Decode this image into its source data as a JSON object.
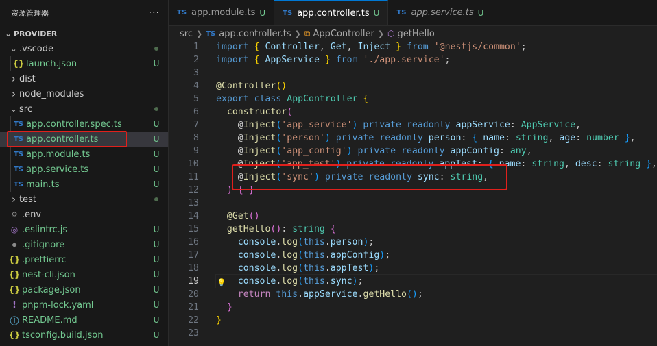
{
  "sidebar": {
    "title": "资源管理器",
    "more": "···",
    "section": "PROVIDER",
    "items": [
      {
        "label": ".vscode",
        "type": "folder",
        "open": true,
        "indent": 1,
        "icon": "",
        "badge": "dot"
      },
      {
        "label": "launch.json",
        "type": "file",
        "indent": 2,
        "icon": "{}",
        "badge": "U"
      },
      {
        "label": "dist",
        "type": "folder",
        "open": false,
        "indent": 1,
        "icon": "",
        "badge": ""
      },
      {
        "label": "node_modules",
        "type": "folder",
        "open": false,
        "indent": 1,
        "icon": "",
        "badge": ""
      },
      {
        "label": "src",
        "type": "folder",
        "open": true,
        "indent": 1,
        "icon": "",
        "badge": "dot"
      },
      {
        "label": "app.controller.spec.ts",
        "type": "file",
        "indent": 2,
        "icon": "TS",
        "badge": "U"
      },
      {
        "label": "app.controller.ts",
        "type": "file",
        "indent": 2,
        "icon": "TS",
        "badge": "U",
        "selected": true
      },
      {
        "label": "app.module.ts",
        "type": "file",
        "indent": 2,
        "icon": "TS",
        "badge": "U"
      },
      {
        "label": "app.service.ts",
        "type": "file",
        "indent": 2,
        "icon": "TS",
        "badge": "U"
      },
      {
        "label": "main.ts",
        "type": "file",
        "indent": 2,
        "icon": "TS",
        "badge": "U"
      },
      {
        "label": "test",
        "type": "folder",
        "open": false,
        "indent": 1,
        "icon": "",
        "badge": "dot"
      },
      {
        "label": ".env",
        "type": "file",
        "indent": 1,
        "icon": "gear",
        "badge": ""
      },
      {
        "label": ".eslintrc.js",
        "type": "file",
        "indent": 1,
        "icon": "eslint",
        "badge": "U"
      },
      {
        "label": ".gitignore",
        "type": "file",
        "indent": 1,
        "icon": "git",
        "badge": "U"
      },
      {
        "label": ".prettierrc",
        "type": "file",
        "indent": 1,
        "icon": "{}",
        "badge": "U"
      },
      {
        "label": "nest-cli.json",
        "type": "file",
        "indent": 1,
        "icon": "{}",
        "badge": "U"
      },
      {
        "label": "package.json",
        "type": "file",
        "indent": 1,
        "icon": "{}",
        "badge": "U"
      },
      {
        "label": "pnpm-lock.yaml",
        "type": "file",
        "indent": 1,
        "icon": "!",
        "badge": "U"
      },
      {
        "label": "README.md",
        "type": "file",
        "indent": 1,
        "icon": "info",
        "badge": "U"
      },
      {
        "label": "tsconfig.build.json",
        "type": "file",
        "indent": 1,
        "icon": "{}",
        "badge": "U"
      }
    ]
  },
  "tabs": [
    {
      "label": "app.module.ts",
      "badge": "U",
      "active": false,
      "preview": false
    },
    {
      "label": "app.controller.ts",
      "badge": "U",
      "active": true,
      "preview": false
    },
    {
      "label": "app.service.ts",
      "badge": "U",
      "active": false,
      "preview": true
    }
  ],
  "tab_icon": "TS",
  "breadcrumb": {
    "folder": "src",
    "file": "app.controller.ts",
    "class": "AppController",
    "method": "getHello"
  },
  "editor": {
    "current_line": 19,
    "lines": [
      [
        [
          "k",
          "import"
        ],
        [
          "p",
          " "
        ],
        [
          "b1",
          "{"
        ],
        [
          "v",
          " Controller"
        ],
        [
          "p",
          ", "
        ],
        [
          "v",
          "Get"
        ],
        [
          "p",
          ", "
        ],
        [
          "v",
          "Inject "
        ],
        [
          "b1",
          "}"
        ],
        [
          "p",
          " "
        ],
        [
          "k",
          "from"
        ],
        [
          "p",
          " "
        ],
        [
          "s",
          "'@nestjs/common'"
        ],
        [
          "p",
          ";"
        ]
      ],
      [
        [
          "k",
          "import"
        ],
        [
          "p",
          " "
        ],
        [
          "b1",
          "{"
        ],
        [
          "v",
          " AppService "
        ],
        [
          "b1",
          "}"
        ],
        [
          "p",
          " "
        ],
        [
          "k",
          "from"
        ],
        [
          "p",
          " "
        ],
        [
          "s",
          "'./app.service'"
        ],
        [
          "p",
          ";"
        ]
      ],
      [],
      [
        [
          "f",
          "@Controller"
        ],
        [
          "b1",
          "("
        ],
        [
          "b1",
          ")"
        ]
      ],
      [
        [
          "k",
          "export"
        ],
        [
          "p",
          " "
        ],
        [
          "k",
          "class"
        ],
        [
          "p",
          " "
        ],
        [
          "t",
          "AppController"
        ],
        [
          "p",
          " "
        ],
        [
          "b1",
          "{"
        ]
      ],
      [
        [
          "p",
          "  "
        ],
        [
          "f",
          "constructor"
        ],
        [
          "b2",
          "("
        ]
      ],
      [
        [
          "p",
          "    @"
        ],
        [
          "f",
          "Inject"
        ],
        [
          "b3",
          "("
        ],
        [
          "s",
          "'app_service'"
        ],
        [
          "b3",
          ")"
        ],
        [
          "p",
          " "
        ],
        [
          "k",
          "private"
        ],
        [
          "p",
          " "
        ],
        [
          "k",
          "readonly"
        ],
        [
          "p",
          " "
        ],
        [
          "v",
          "appService"
        ],
        [
          "p",
          ": "
        ],
        [
          "t",
          "AppService"
        ],
        [
          "p",
          ","
        ]
      ],
      [
        [
          "p",
          "    @"
        ],
        [
          "f",
          "Inject"
        ],
        [
          "b3",
          "("
        ],
        [
          "s",
          "'person'"
        ],
        [
          "b3",
          ")"
        ],
        [
          "p",
          " "
        ],
        [
          "k",
          "private"
        ],
        [
          "p",
          " "
        ],
        [
          "k",
          "readonly"
        ],
        [
          "p",
          " "
        ],
        [
          "v",
          "person"
        ],
        [
          "p",
          ": "
        ],
        [
          "b3",
          "{"
        ],
        [
          "p",
          " "
        ],
        [
          "v",
          "name"
        ],
        [
          "p",
          ": "
        ],
        [
          "t",
          "string"
        ],
        [
          "p",
          ", "
        ],
        [
          "v",
          "age"
        ],
        [
          "p",
          ": "
        ],
        [
          "t",
          "number"
        ],
        [
          "p",
          " "
        ],
        [
          "b3",
          "}"
        ],
        [
          "p",
          ","
        ]
      ],
      [
        [
          "p",
          "    @"
        ],
        [
          "f",
          "Inject"
        ],
        [
          "b3",
          "("
        ],
        [
          "s",
          "'app_config'"
        ],
        [
          "b3",
          ")"
        ],
        [
          "p",
          " "
        ],
        [
          "k",
          "private"
        ],
        [
          "p",
          " "
        ],
        [
          "k",
          "readonly"
        ],
        [
          "p",
          " "
        ],
        [
          "v",
          "appConfig"
        ],
        [
          "p",
          ": "
        ],
        [
          "t",
          "any"
        ],
        [
          "p",
          ","
        ]
      ],
      [
        [
          "p",
          "    @"
        ],
        [
          "f",
          "Inject"
        ],
        [
          "b3",
          "("
        ],
        [
          "s",
          "'app_test'"
        ],
        [
          "b3",
          ")"
        ],
        [
          "p",
          " "
        ],
        [
          "k",
          "private"
        ],
        [
          "p",
          " "
        ],
        [
          "k",
          "readonly"
        ],
        [
          "p",
          " "
        ],
        [
          "v",
          "appTest"
        ],
        [
          "p",
          ": "
        ],
        [
          "b3",
          "{"
        ],
        [
          "p",
          " "
        ],
        [
          "v",
          "name"
        ],
        [
          "p",
          ": "
        ],
        [
          "t",
          "string"
        ],
        [
          "p",
          ", "
        ],
        [
          "v",
          "desc"
        ],
        [
          "p",
          ": "
        ],
        [
          "t",
          "string"
        ],
        [
          "p",
          " "
        ],
        [
          "b3",
          "}"
        ],
        [
          "p",
          ","
        ]
      ],
      [
        [
          "p",
          "    @"
        ],
        [
          "f",
          "Inject"
        ],
        [
          "b3",
          "("
        ],
        [
          "s",
          "'sync'"
        ],
        [
          "b3",
          ")"
        ],
        [
          "p",
          " "
        ],
        [
          "k",
          "private"
        ],
        [
          "p",
          " "
        ],
        [
          "k",
          "readonly"
        ],
        [
          "p",
          " "
        ],
        [
          "v",
          "sync"
        ],
        [
          "p",
          ": "
        ],
        [
          "t",
          "string"
        ],
        [
          "p",
          ","
        ]
      ],
      [
        [
          "p",
          "  "
        ],
        [
          "b2",
          ")"
        ],
        [
          "p",
          " "
        ],
        [
          "b2",
          "{"
        ],
        [
          "p",
          " "
        ],
        [
          "b2",
          "}"
        ]
      ],
      [],
      [
        [
          "p",
          "  "
        ],
        [
          "f",
          "@Get"
        ],
        [
          "b2",
          "("
        ],
        [
          "b2",
          ")"
        ]
      ],
      [
        [
          "p",
          "  "
        ],
        [
          "f",
          "getHello"
        ],
        [
          "b2",
          "("
        ],
        [
          "b2",
          ")"
        ],
        [
          "p",
          ": "
        ],
        [
          "t",
          "string"
        ],
        [
          "p",
          " "
        ],
        [
          "b2",
          "{"
        ]
      ],
      [
        [
          "p",
          "    "
        ],
        [
          "v",
          "console"
        ],
        [
          "p",
          "."
        ],
        [
          "f",
          "log"
        ],
        [
          "b3",
          "("
        ],
        [
          "k",
          "this"
        ],
        [
          "p",
          "."
        ],
        [
          "v",
          "person"
        ],
        [
          "b3",
          ")"
        ],
        [
          "p",
          ";"
        ]
      ],
      [
        [
          "p",
          "    "
        ],
        [
          "v",
          "console"
        ],
        [
          "p",
          "."
        ],
        [
          "f",
          "log"
        ],
        [
          "b3",
          "("
        ],
        [
          "k",
          "this"
        ],
        [
          "p",
          "."
        ],
        [
          "v",
          "appConfig"
        ],
        [
          "b3",
          ")"
        ],
        [
          "p",
          ";"
        ]
      ],
      [
        [
          "p",
          "    "
        ],
        [
          "v",
          "console"
        ],
        [
          "p",
          "."
        ],
        [
          "f",
          "log"
        ],
        [
          "b3",
          "("
        ],
        [
          "k",
          "this"
        ],
        [
          "p",
          "."
        ],
        [
          "v",
          "appTest"
        ],
        [
          "b3",
          ")"
        ],
        [
          "p",
          ";"
        ]
      ],
      [
        [
          "p",
          "    "
        ],
        [
          "v",
          "console"
        ],
        [
          "p",
          "."
        ],
        [
          "f",
          "log"
        ],
        [
          "b3",
          "("
        ],
        [
          "k",
          "this"
        ],
        [
          "p",
          "."
        ],
        [
          "v",
          "sync"
        ],
        [
          "b3",
          ")"
        ],
        [
          "p",
          ";"
        ]
      ],
      [
        [
          "p",
          "    "
        ],
        [
          "kc",
          "return"
        ],
        [
          "p",
          " "
        ],
        [
          "k",
          "this"
        ],
        [
          "p",
          "."
        ],
        [
          "v",
          "appService"
        ],
        [
          "p",
          "."
        ],
        [
          "f",
          "getHello"
        ],
        [
          "b3",
          "("
        ],
        [
          "b3",
          ")"
        ],
        [
          "p",
          ";"
        ]
      ],
      [
        [
          "p",
          "  "
        ],
        [
          "b2",
          "}"
        ]
      ],
      [
        [
          "b1",
          "}"
        ]
      ],
      []
    ]
  },
  "colors": {
    "background": "#1f1f1f",
    "sidebar": "#181818",
    "selection": "#37373d",
    "highlight_box": "#e0201c",
    "untracked": "#73c991",
    "ts_icon": "#3178c6"
  }
}
